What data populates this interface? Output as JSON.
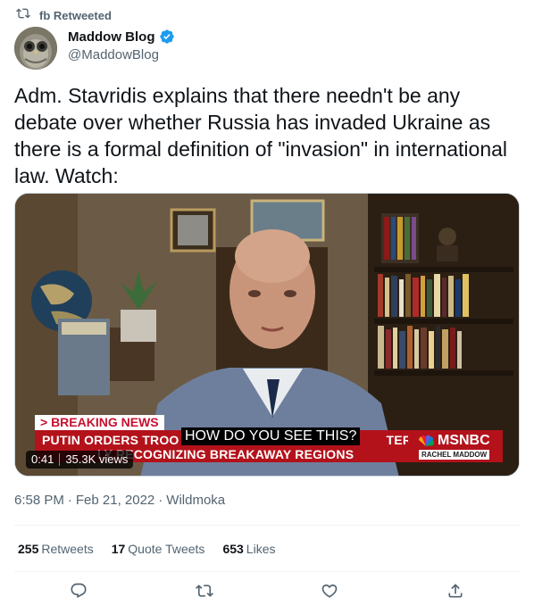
{
  "retweet": {
    "label": "fb Retweeted",
    "icon": "retweet-icon"
  },
  "author": {
    "display_name": "Maddow Blog",
    "handle": "@MaddowBlog",
    "verified_icon": "verified-badge-icon",
    "verified_color": "#1d9bf0"
  },
  "tweet": {
    "text": "Adm. Stavridis explains that there needn't be any debate over whether Russia has invaded Ukraine as there is a formal definition of \"invasion\" in international law. Watch:"
  },
  "video": {
    "breaking_label": "> BREAKING NEWS",
    "headline_line1": "PUTIN ORDERS TROO",
    "headline_line1_tail": "TER",
    "headline_line2_head": "LY RECOGNIZING BREAKAWAY REGIONS",
    "subtitle": "HOW DO YOU SEE THIS?",
    "network": "MSNBC",
    "show": "RACHEL MADDOW",
    "time": "0:41",
    "views": "35.3K views",
    "accent_color": "#b3121b"
  },
  "meta": {
    "time": "6:58 PM",
    "date": "Feb 21, 2022",
    "source": "Wildmoka",
    "separator": "·"
  },
  "stats": {
    "retweets_count": "255",
    "retweets_label": "Retweets",
    "quotes_count": "17",
    "quotes_label": "Quote Tweets",
    "likes_count": "653",
    "likes_label": "Likes"
  },
  "actions": {
    "reply_icon": "reply-icon",
    "retweet_icon": "retweet-icon",
    "like_icon": "heart-icon",
    "share_icon": "share-icon"
  },
  "colors": {
    "text": "#0f1419",
    "secondary": "#536471",
    "divider": "#eff3f4"
  }
}
